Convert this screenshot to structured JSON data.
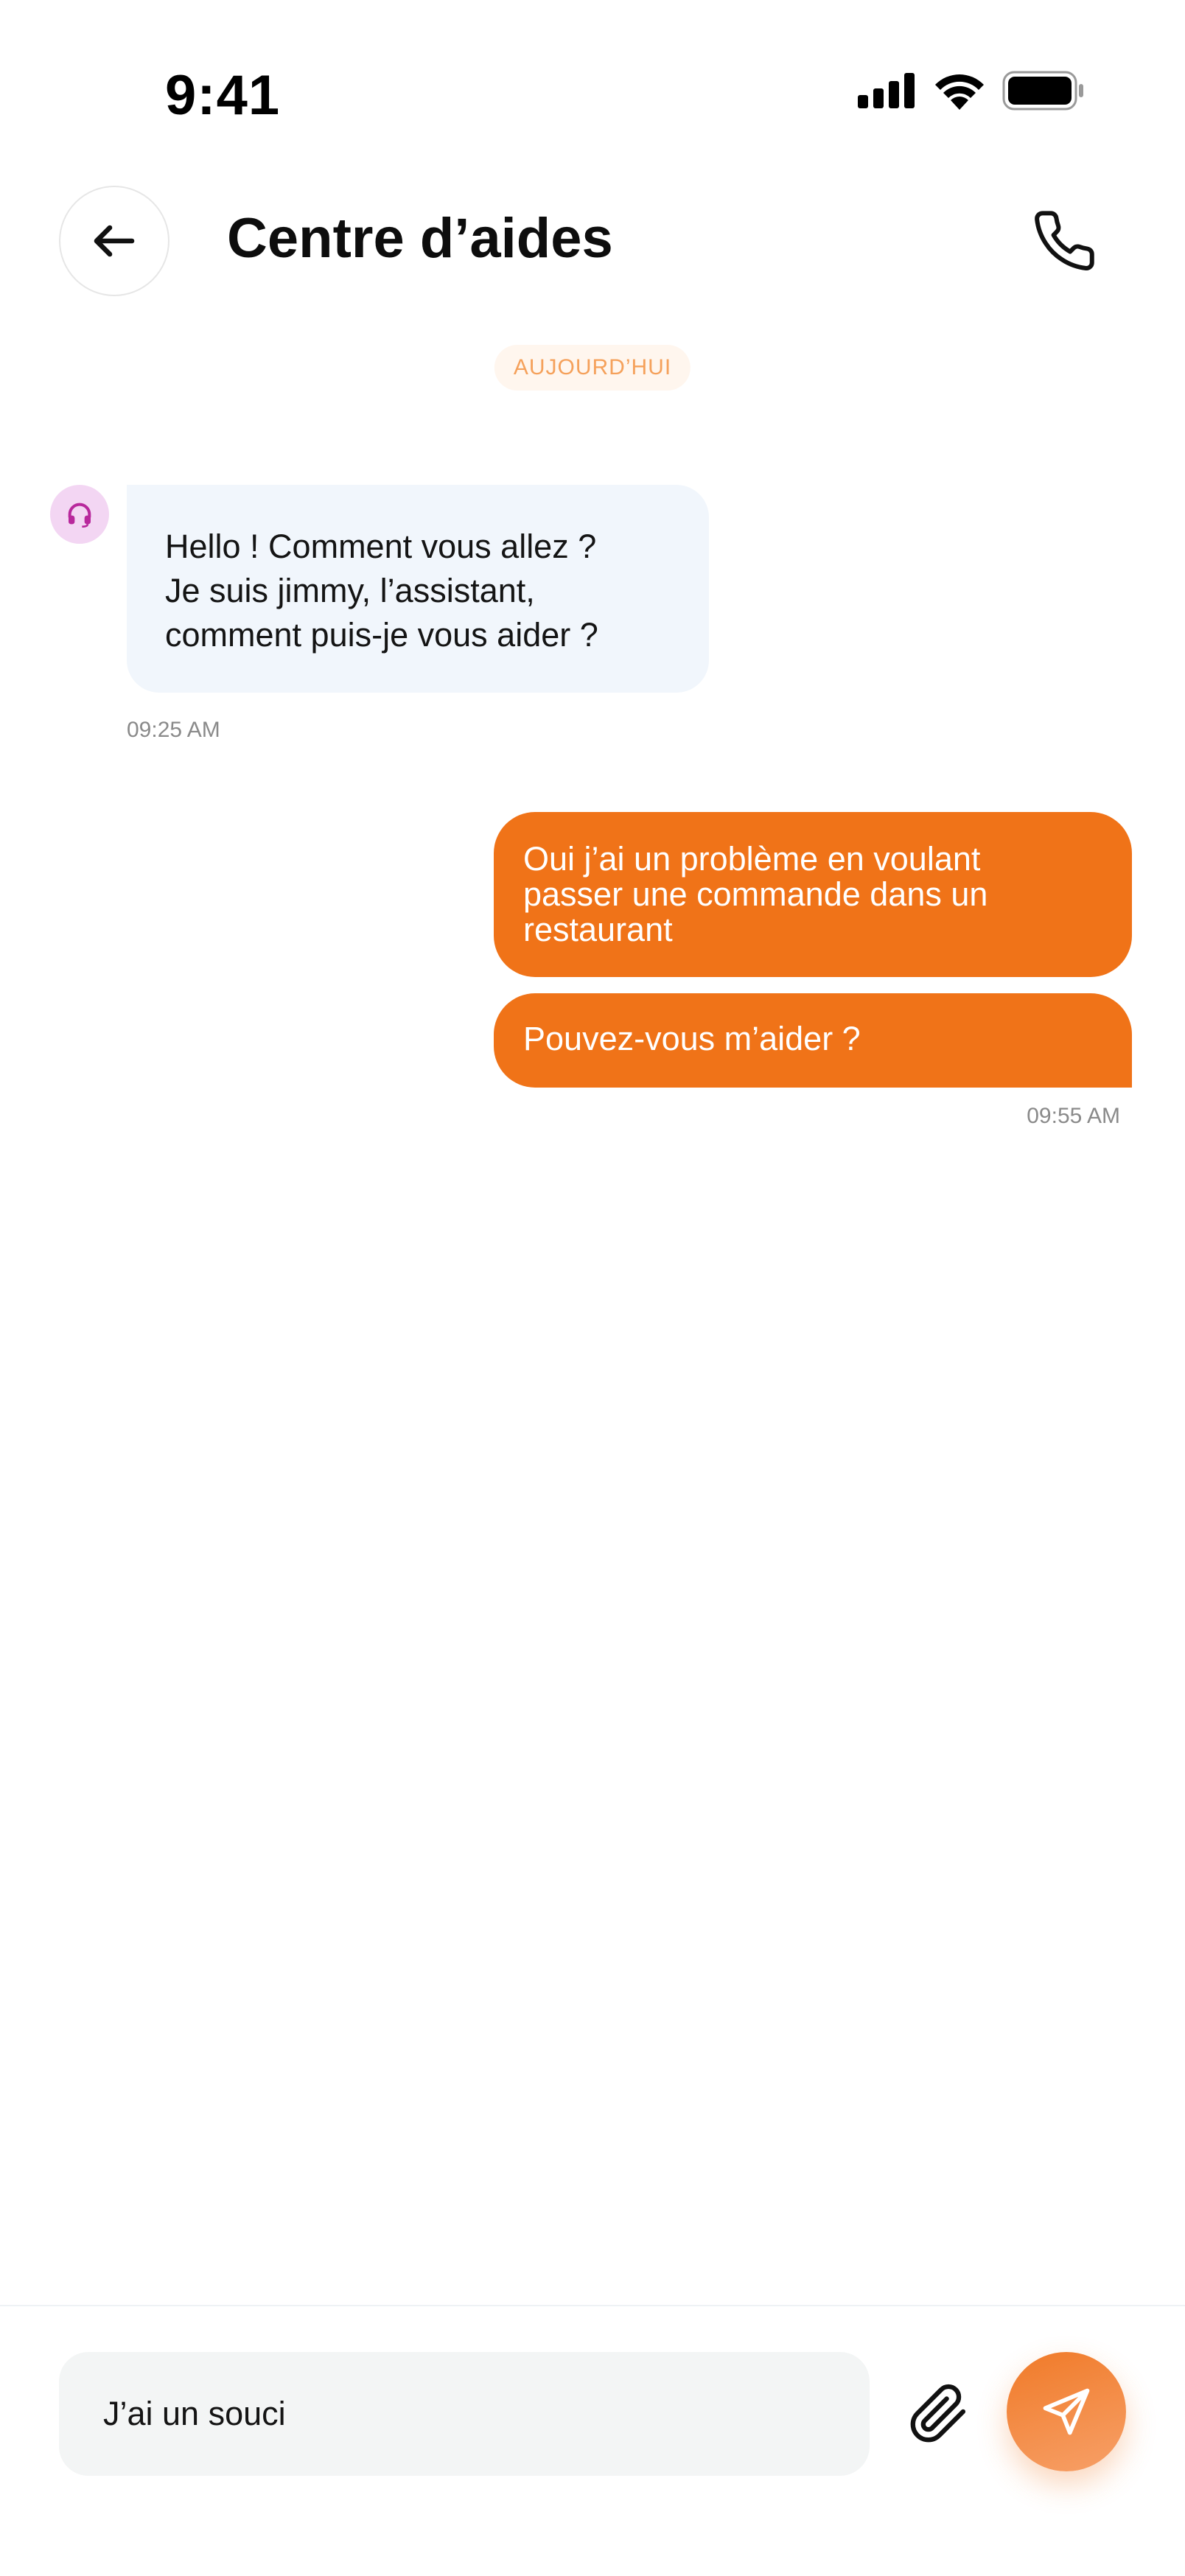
{
  "status_bar": {
    "time": "9:41"
  },
  "header": {
    "title": "Centre d’aides",
    "back_icon": "arrow-left-icon",
    "call_icon": "phone-icon"
  },
  "chat": {
    "date_label": "AUJOURD’HUI",
    "incoming": {
      "avatar_icon": "headset-icon",
      "lines": [
        "Hello ! Comment vous allez ?",
        "Je suis jimmy, l’assistant,",
        "comment puis-je vous aider ?"
      ],
      "time": "09:25 AM"
    },
    "outgoing": [
      {
        "lines": [
          "Oui j’ai un problème en voulant",
          "passer une commande dans un",
          "restaurant"
        ]
      },
      {
        "text": "Pouvez-vous m’aider ?"
      }
    ],
    "outgoing_time": "09:55 AM"
  },
  "composer": {
    "input_value": "J’ai un souci",
    "attach_icon": "paperclip-icon",
    "send_icon": "send-icon"
  },
  "colors": {
    "accent": "#F07318",
    "incoming_bubble": "#F1F6FC",
    "date_chip_text": "#F5A15B",
    "avatar_bg": "#F3D6F3"
  }
}
